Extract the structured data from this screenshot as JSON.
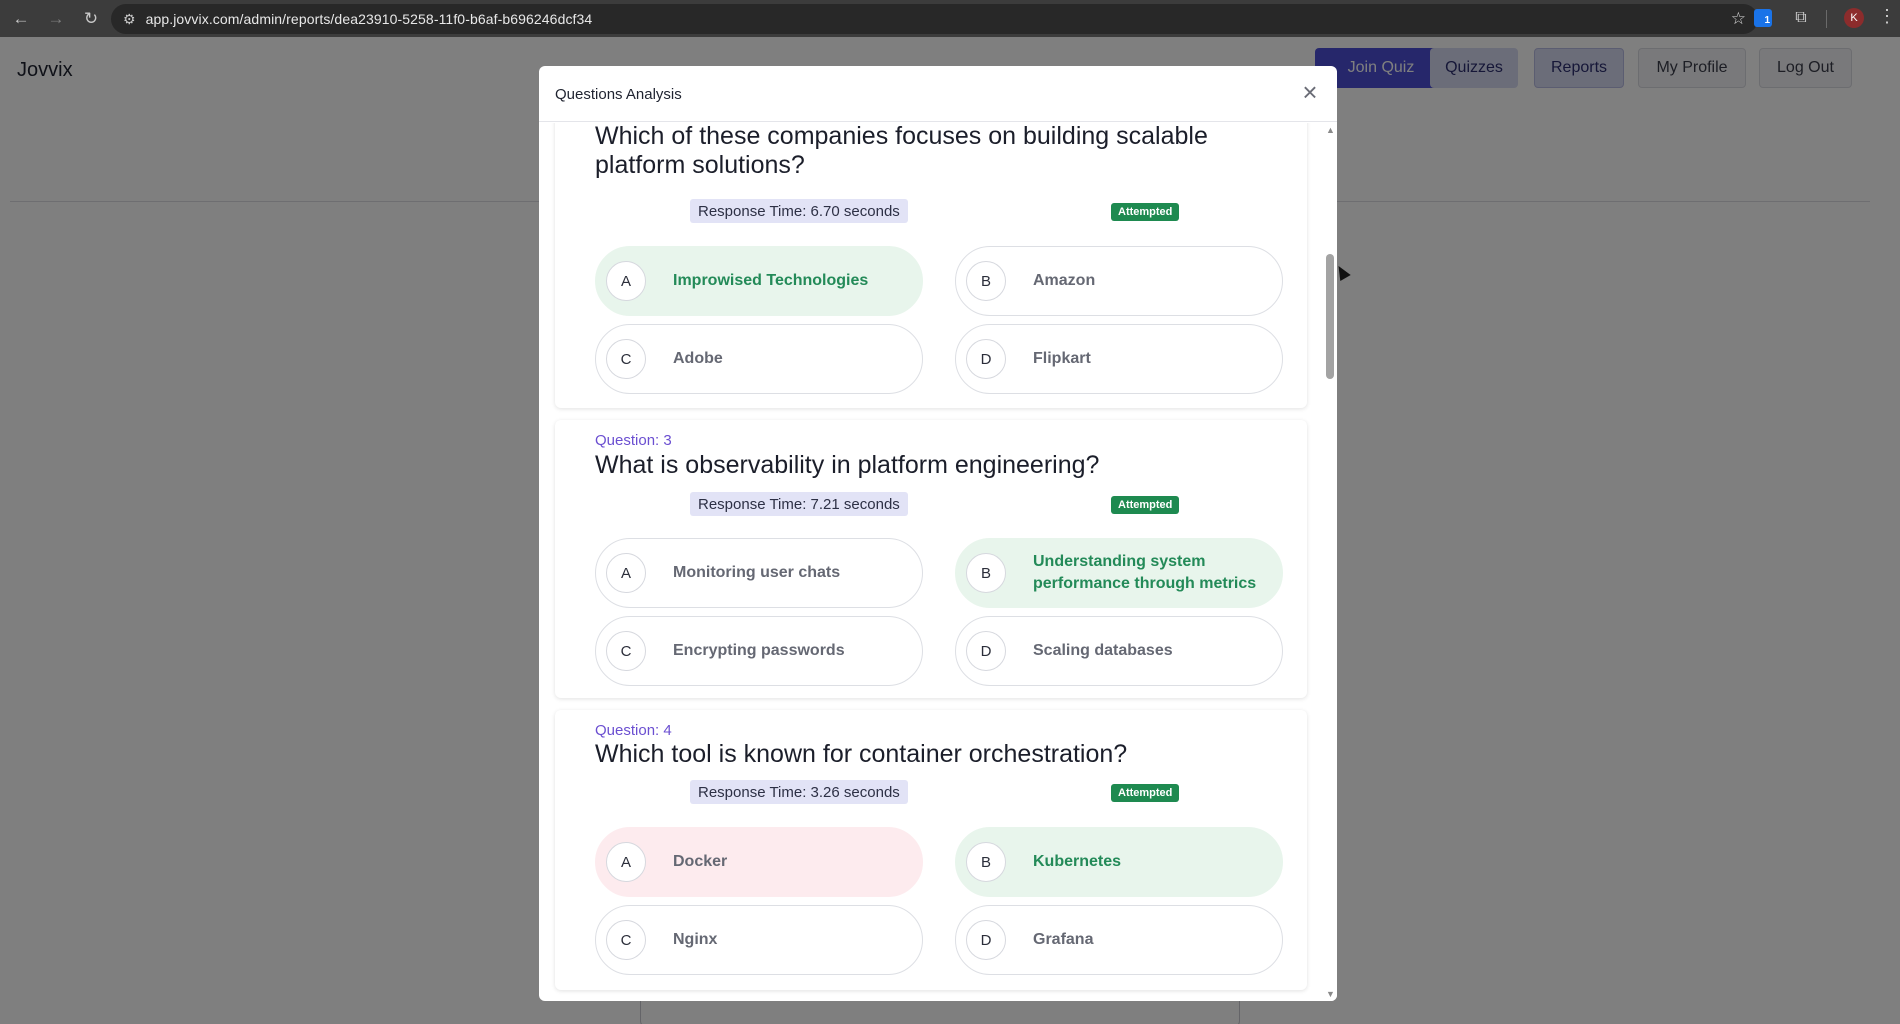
{
  "browser": {
    "url": "app.jovvix.com/admin/reports/dea23910-5258-11f0-b6af-b696246dcf34",
    "back_icon": "arrow-left-icon",
    "forward_icon": "arrow-right-icon",
    "reload_icon": "reload-icon",
    "profile_initial": "K",
    "ext_badge": "1"
  },
  "app": {
    "logo": "Jovvix",
    "nav": {
      "join_quiz": "Join Quiz",
      "quizzes": "Quizzes",
      "reports": "Reports",
      "my_profile": "My Profile",
      "log_out": "Log Out"
    }
  },
  "modal": {
    "title": "Questions Analysis",
    "close": "×",
    "questions": [
      {
        "number": "",
        "text": "Which of these companies focuses on building scalable platform solutions?",
        "response_time": "Response Time: 6.70 seconds",
        "status": "Attempted",
        "options": [
          {
            "letter": "A",
            "text": "Improwised Technologies",
            "state": "correct"
          },
          {
            "letter": "B",
            "text": "Amazon",
            "state": "neutral"
          },
          {
            "letter": "C",
            "text": "Adobe",
            "state": "neutral"
          },
          {
            "letter": "D",
            "text": "Flipkart",
            "state": "neutral"
          }
        ]
      },
      {
        "number": "Question: 3",
        "text": "What is observability in platform engineering?",
        "response_time": "Response Time: 7.21 seconds",
        "status": "Attempted",
        "options": [
          {
            "letter": "A",
            "text": "Monitoring user chats",
            "state": "neutral"
          },
          {
            "letter": "B",
            "text": "Understanding system performance through metrics",
            "state": "correct"
          },
          {
            "letter": "C",
            "text": "Encrypting passwords",
            "state": "neutral"
          },
          {
            "letter": "D",
            "text": "Scaling databases",
            "state": "neutral"
          }
        ]
      },
      {
        "number": "Question: 4",
        "text": "Which tool is known for container orchestration?",
        "response_time": "Response Time: 3.26 seconds",
        "status": "Attempted",
        "options": [
          {
            "letter": "A",
            "text": "Docker",
            "state": "wrong"
          },
          {
            "letter": "B",
            "text": "Kubernetes",
            "state": "correct"
          },
          {
            "letter": "C",
            "text": "Nginx",
            "state": "neutral"
          },
          {
            "letter": "D",
            "text": "Grafana",
            "state": "neutral"
          }
        ]
      }
    ]
  },
  "colors": {
    "accent": "#4c4fd6",
    "correct_bg": "#e8f5ec",
    "correct_text": "#238a58",
    "wrong_bg": "#fdebee",
    "attempted_badge": "#1e8a50",
    "question_number": "#6b4fd1"
  }
}
